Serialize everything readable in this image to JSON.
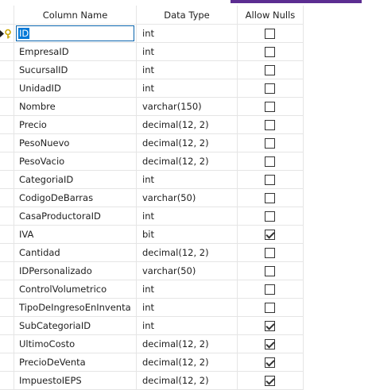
{
  "columns": {
    "name": "Column Name",
    "type": "Data Type",
    "nulls": "Allow Nulls"
  },
  "rows": [
    {
      "name": "ID",
      "type": "int",
      "allow_nulls": false,
      "primary_key": true,
      "selected": true
    },
    {
      "name": "EmpresaID",
      "type": "int",
      "allow_nulls": false
    },
    {
      "name": "SucursalID",
      "type": "int",
      "allow_nulls": false
    },
    {
      "name": "UnidadID",
      "type": "int",
      "allow_nulls": false
    },
    {
      "name": "Nombre",
      "type": "varchar(150)",
      "allow_nulls": false
    },
    {
      "name": "Precio",
      "type": "decimal(12, 2)",
      "allow_nulls": false
    },
    {
      "name": "PesoNuevo",
      "type": "decimal(12, 2)",
      "allow_nulls": false
    },
    {
      "name": "PesoVacio",
      "type": "decimal(12, 2)",
      "allow_nulls": false
    },
    {
      "name": "CategoriaID",
      "type": "int",
      "allow_nulls": false
    },
    {
      "name": "CodigoDeBarras",
      "type": "varchar(50)",
      "allow_nulls": false
    },
    {
      "name": "CasaProductoraID",
      "type": "int",
      "allow_nulls": false
    },
    {
      "name": "IVA",
      "type": "bit",
      "allow_nulls": true
    },
    {
      "name": "Cantidad",
      "type": "decimal(12, 2)",
      "allow_nulls": false
    },
    {
      "name": "IDPersonalizado",
      "type": "varchar(50)",
      "allow_nulls": false
    },
    {
      "name": "ControlVolumetrico",
      "type": "int",
      "allow_nulls": false
    },
    {
      "name": "TipoDeIngresoEnInventa",
      "type": "int",
      "allow_nulls": false
    },
    {
      "name": "SubCategoriaID",
      "type": "int",
      "allow_nulls": true
    },
    {
      "name": "UltimoCosto",
      "type": "decimal(12, 2)",
      "allow_nulls": true
    },
    {
      "name": "PrecioDeVenta",
      "type": "decimal(12, 2)",
      "allow_nulls": true
    },
    {
      "name": "ImpuestoIEPS",
      "type": "decimal(12, 2)",
      "allow_nulls": true
    }
  ],
  "colors": {
    "selection": "#0078d7",
    "editor_border": "#0a64ad",
    "grid_lines": "#e5e5e5",
    "key_icon": "#c9a400"
  },
  "icons": {
    "row_marker": "current-row-arrow-icon",
    "key": "primary-key-icon"
  }
}
